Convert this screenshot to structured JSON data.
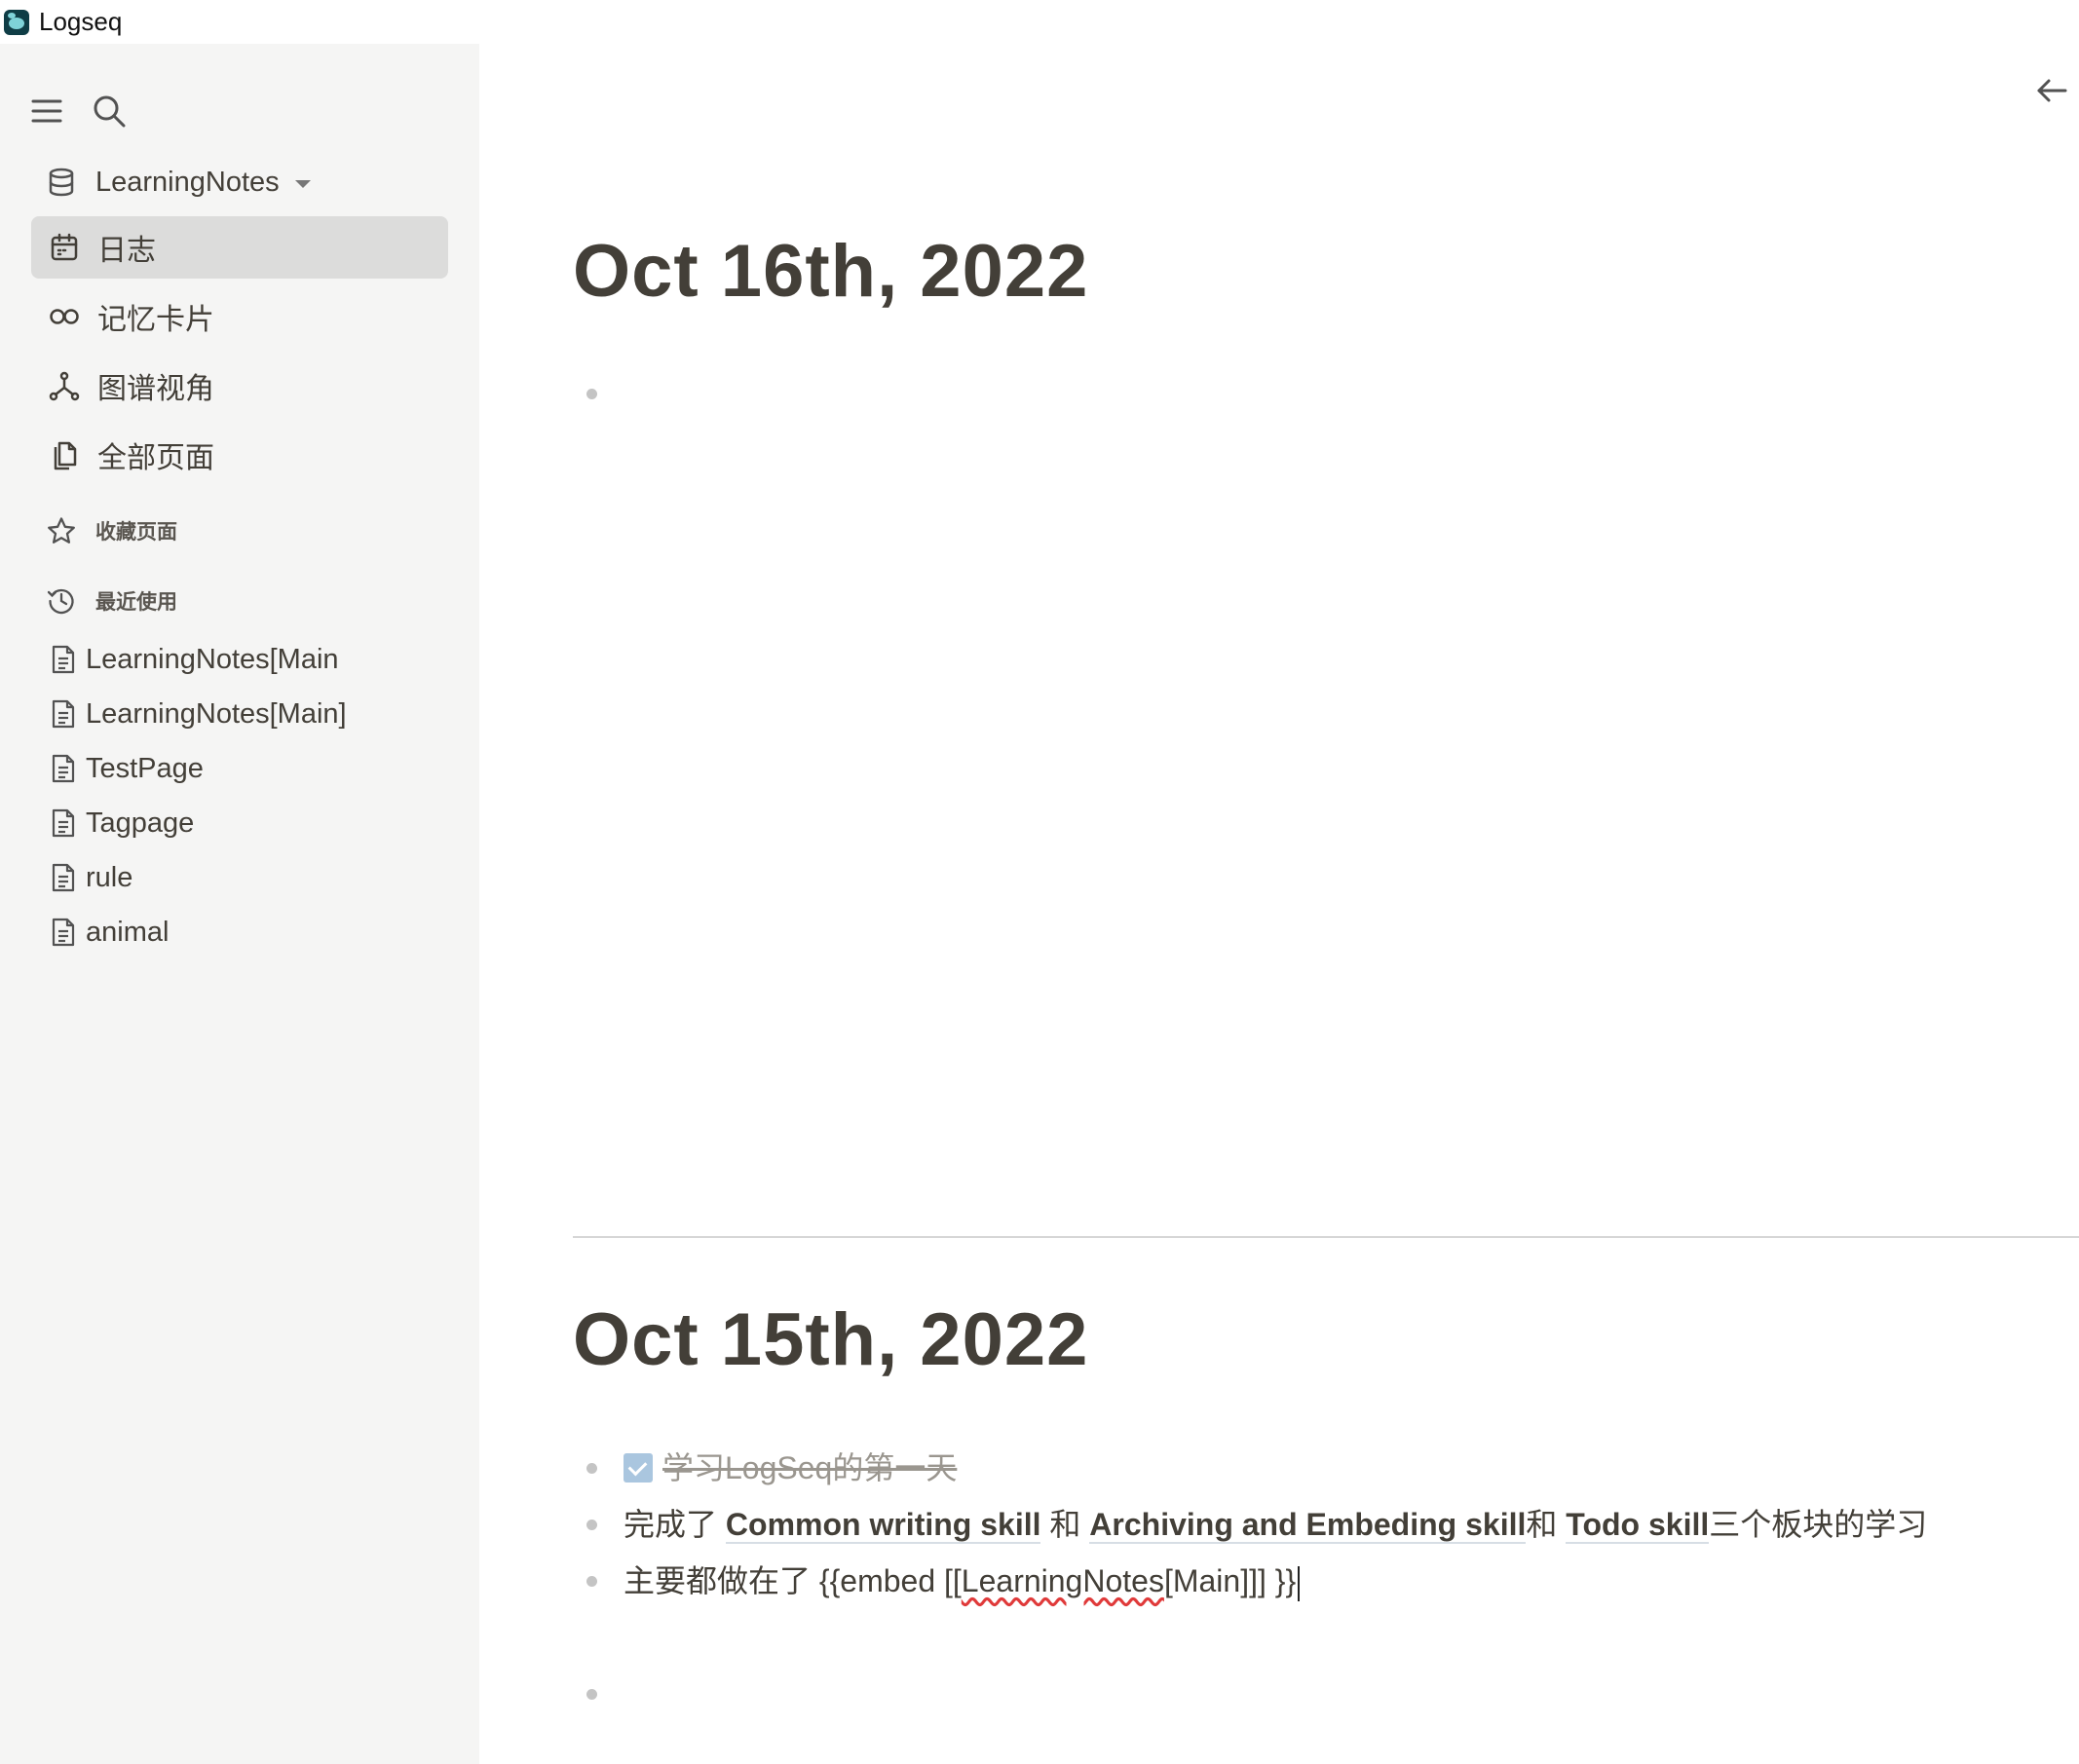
{
  "app": {
    "title": "Logseq"
  },
  "sidebar": {
    "graph_name": "LearningNotes",
    "nav": [
      {
        "label": "日志"
      },
      {
        "label": "记忆卡片"
      },
      {
        "label": "图谱视角"
      },
      {
        "label": "全部页面"
      }
    ],
    "favorites_label": "收藏页面",
    "recent_label": "最近使用",
    "recent": [
      {
        "label": "LearningNotes[Main"
      },
      {
        "label": "LearningNotes[Main]"
      },
      {
        "label": "TestPage"
      },
      {
        "label": "Tagpage"
      },
      {
        "label": "rule"
      },
      {
        "label": "animal"
      }
    ]
  },
  "journals": [
    {
      "title": "Oct 16th, 2022"
    },
    {
      "title": "Oct 15th, 2022",
      "blocks": {
        "todo_done": "学习LogSeq的第一天",
        "line2": {
          "prefix": "完成了 ",
          "ref1": "Common writing skill",
          "sep1": " 和 ",
          "ref2": "Archiving and Embeding skill",
          "sep2": "和 ",
          "ref3": "Todo skill",
          "suffix": "三个板块的学习"
        },
        "line3": {
          "prefix": "主要都做在了 {{embed [[",
          "misspelled": "LearningNotes",
          "suffix": "[Main]]] }}"
        }
      }
    }
  ],
  "colors": {
    "sidebar_bg": "#f5f5f4",
    "active_nav_bg": "#dcdcdb",
    "text": "#433f38",
    "checkbox": "#aac6df"
  }
}
